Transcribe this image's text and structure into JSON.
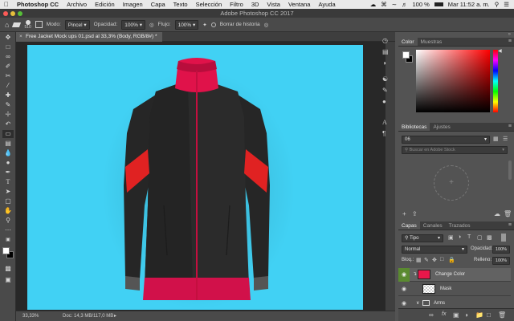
{
  "menubar": {
    "apple": "",
    "app": "Photoshop CC",
    "items": [
      "Archivo",
      "Edición",
      "Imagen",
      "Capa",
      "Texto",
      "Selección",
      "Filtro",
      "3D",
      "Vista",
      "Ventana",
      "Ayuda"
    ],
    "battery": "100 %",
    "clock": "Mar 11:52 a. m."
  },
  "window": {
    "title": "Adobe Photoshop CC 2017"
  },
  "options": {
    "brush_size": "510",
    "mode_label": "Modo:",
    "mode_value": "Pincel",
    "opacity_label": "Opacidad:",
    "opacity_value": "100%",
    "flow_label": "Flujo:",
    "flow_value": "100%",
    "history_label": "Borrar de historia"
  },
  "document": {
    "tab_title": "Free Jacket Mock ups 01.psd al 33,3% (Body, RGB/8#) *",
    "zoom": "33,33%",
    "doc_info": "Doc: 14,3 MB/117,0 MB"
  },
  "color_panel": {
    "tabs": [
      "Color",
      "Muestras"
    ],
    "foreground": "#ffffff",
    "background": "#000000"
  },
  "libraries_panel": {
    "tabs": [
      "Bibliotecas",
      "Ajustes"
    ],
    "library_name": "06",
    "search_placeholder": "Buscar en Adobe Stock"
  },
  "layers_panel": {
    "tabs": [
      "Capas",
      "Canales",
      "Trazados"
    ],
    "filter_label": "Tipo",
    "blend_mode": "Normal",
    "opacity_label": "Opacidad:",
    "opacity_value": "100%",
    "lock_label": "Bloq.:",
    "fill_label": "Relleno:",
    "fill_value": "100%",
    "layers": [
      {
        "name": "Change Color",
        "thumb_color": "#e8174a",
        "selected": true
      },
      {
        "name": "Mask"
      },
      {
        "name": "Arms"
      },
      {
        "name": ""
      }
    ]
  },
  "colors": {
    "canvas_bg": "#41d1f4",
    "jacket_body": "#2a2a2a",
    "jacket_accent": "#e0124a",
    "stripe_red": "#e02222",
    "layer_selected_eye_bg": "#5a8a30"
  }
}
